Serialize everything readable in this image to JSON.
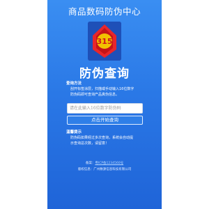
{
  "header": {
    "title": "商品数码防伪中心"
  },
  "logo": {
    "number": "315",
    "icon": "brand-emblem-icon"
  },
  "main": {
    "title": "防伪查询"
  },
  "method": {
    "heading": "查询方法",
    "line1": "刮开标签涂层，扫描或手动输入16位数字",
    "line2": "防伪码即可查询产品真伪信息。"
  },
  "search": {
    "placeholder": "请在此输入16位数字防伪码",
    "button_label": "点击开始查询"
  },
  "tips": {
    "heading": "温馨提示",
    "line1": "防伪码如果经过多次查询，系统会自动提",
    "line2": "示查询总次数，请留意！"
  },
  "footer": {
    "record_label": "备案：",
    "record_link": "粤ICP备1234560号",
    "copyright": "版权信息：广州数源信息科技有限公司"
  },
  "colors": {
    "background_top": "#3a8ef2",
    "background_bottom": "#1f64d8",
    "logo_bg": "#1e50b8",
    "logo_red": "#e8262b",
    "logo_gold": "#f2c200"
  }
}
